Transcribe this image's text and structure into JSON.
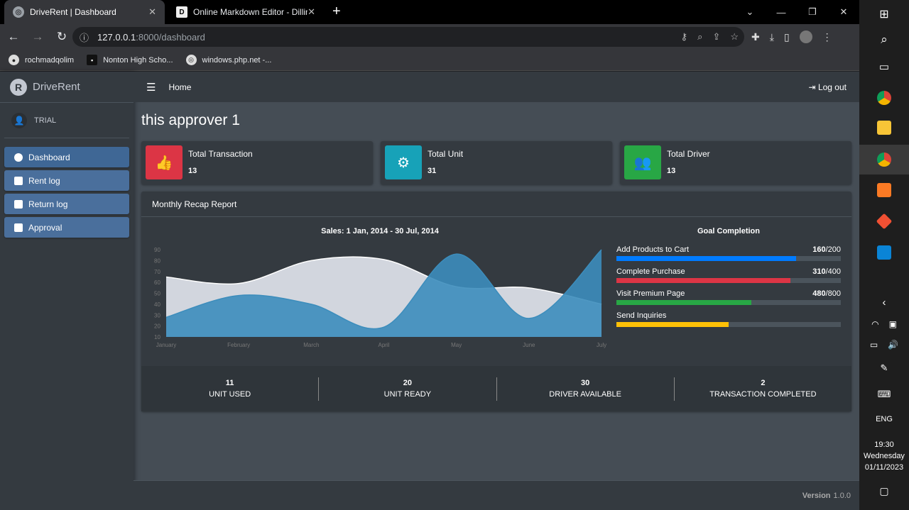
{
  "browser": {
    "tabs": [
      {
        "title": "DriveRent | Dashboard",
        "favicon": "globe"
      },
      {
        "title": "Online Markdown Editor - Dilling",
        "favicon": "D"
      }
    ],
    "url_host": "127.0.0.1",
    "url_path": ":8000/dashboard",
    "bookmarks": [
      "rochmadqolim",
      "Nonton High Scho...",
      "windows.php.net -..."
    ]
  },
  "sidebar": {
    "brand": "DriveRent",
    "user": "TRIAL",
    "items": [
      {
        "label": "Dashboard"
      },
      {
        "label": "Rent log"
      },
      {
        "label": "Return log"
      },
      {
        "label": "Approval"
      }
    ]
  },
  "topnav": {
    "home": "Home",
    "logout": "Log out"
  },
  "page": {
    "title": "this approver 1"
  },
  "info_boxes": [
    {
      "label": "Total Transaction",
      "value": "13",
      "color": "#dc3545",
      "icon": "thumbs-up-icon"
    },
    {
      "label": "Total Unit",
      "value": "31",
      "color": "#17a2b8",
      "icon": "gear-icon"
    },
    {
      "label": "Total Driver",
      "value": "13",
      "color": "#28a745",
      "icon": "users-icon"
    }
  ],
  "report": {
    "title": "Monthly Recap Report",
    "sales_title": "Sales: 1 Jan, 2014 - 30 Jul, 2014",
    "goal_title": "Goal Completion",
    "goals": [
      {
        "label": "Add Products to Cart",
        "current": "160",
        "total": "/200",
        "fraction": 0.8,
        "color": "#007bff"
      },
      {
        "label": "Complete Purchase",
        "current": "310",
        "total": "/400",
        "fraction": 0.775,
        "color": "#dc3545"
      },
      {
        "label": "Visit Premium Page",
        "current": "480",
        "total": "/800",
        "fraction": 0.6,
        "color": "#28a745"
      },
      {
        "label": "Send Inquiries",
        "current": "",
        "total": "",
        "fraction": 0.5,
        "color": "#ffc107"
      }
    ],
    "stats": [
      {
        "value": "11",
        "label": "UNIT USED"
      },
      {
        "value": "20",
        "label": "UNIT READY"
      },
      {
        "value": "30",
        "label": "DRIVER AVAILABLE"
      },
      {
        "value": "2",
        "label": "TRANSACTION COMPLETED"
      }
    ]
  },
  "chart_data": {
    "type": "area",
    "categories": [
      "January",
      "February",
      "March",
      "April",
      "May",
      "June",
      "July"
    ],
    "ylim": [
      10,
      90
    ],
    "yticks": [
      10,
      20,
      30,
      40,
      50,
      60,
      70,
      80,
      90
    ],
    "series": [
      {
        "values": [
          65,
          59,
          80,
          81,
          56,
          55,
          40
        ],
        "color": "#d2d6de"
      },
      {
        "values": [
          28,
          48,
          40,
          19,
          86,
          27,
          90
        ],
        "color": "#3c8dbc"
      }
    ]
  },
  "footer": {
    "label": "Version",
    "version": "1.0.0"
  },
  "taskbar": {
    "lang": "ENG",
    "time": "19:30",
    "day": "Wednesday",
    "date": "01/11/2023"
  }
}
